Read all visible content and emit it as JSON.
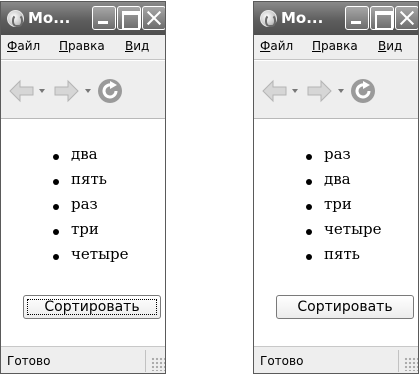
{
  "windows": [
    {
      "title": "Mo...",
      "menu": [
        "Файл",
        "Правка",
        "Вид"
      ],
      "list": [
        "два",
        "пять",
        "раз",
        "три",
        "четыре"
      ],
      "button": "Сортировать",
      "button_focused": true,
      "status": "Готово"
    },
    {
      "title": "Mo...",
      "menu": [
        "Файл",
        "Правка",
        "Вид"
      ],
      "list": [
        "раз",
        "два",
        "три",
        "четыре",
        "пять"
      ],
      "button": "Сортировать",
      "button_focused": false,
      "status": "Готово"
    }
  ],
  "icons": {
    "app": "browser-globe-icon",
    "back": "back-arrow-icon",
    "forward": "forward-arrow-icon",
    "reload": "reload-icon",
    "minimize": "minimize-icon",
    "maximize": "maximize-icon",
    "close": "close-icon"
  },
  "colors": {
    "titlebar": "#5e5e5e",
    "chrome": "#eeeeee",
    "content": "#ffffff"
  }
}
